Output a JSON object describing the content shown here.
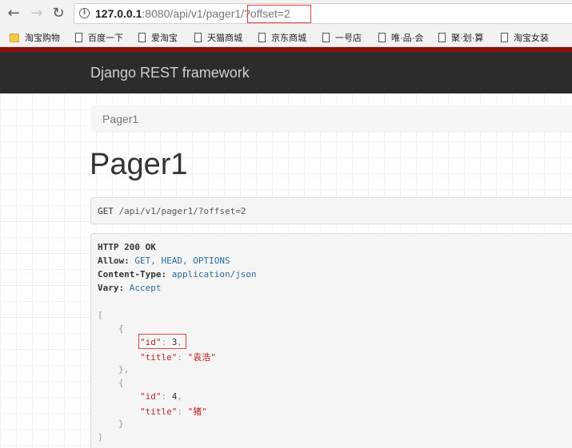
{
  "browser": {
    "back_icon": "arrow-left-icon",
    "forward_icon": "arrow-right-icon",
    "reload_icon": "reload-icon",
    "info_icon": "info-icon",
    "url_host": "127.0.0.1",
    "url_path": ":8080/api/v1/pager1/",
    "url_query": "?offset=2"
  },
  "bookmarks": [
    {
      "label": "淘宝购物",
      "icon": "folder-icon"
    },
    {
      "label": "百度一下",
      "icon": "page-icon"
    },
    {
      "label": "爱淘宝",
      "icon": "page-icon"
    },
    {
      "label": "天猫商城",
      "icon": "page-icon"
    },
    {
      "label": "京东商城",
      "icon": "page-icon"
    },
    {
      "label": "一号店",
      "icon": "page-icon"
    },
    {
      "label": "唯·品·会",
      "icon": "page-icon"
    },
    {
      "label": "聚·划·算",
      "icon": "page-icon"
    },
    {
      "label": "淘宝女装",
      "icon": "page-icon"
    }
  ],
  "navbar": {
    "brand": "Django REST framework"
  },
  "breadcrumb": {
    "item": "Pager1"
  },
  "page": {
    "title": "Pager1"
  },
  "request": {
    "method": "GET",
    "path": "/api/v1/pager1/?offset=2"
  },
  "response": {
    "status_line": "HTTP 200 OK",
    "headers": [
      {
        "key": "Allow:",
        "value": "GET, HEAD, OPTIONS"
      },
      {
        "key": "Content-Type:",
        "value": "application/json"
      },
      {
        "key": "Vary:",
        "value": "Accept"
      }
    ],
    "body": {
      "open_bracket": "[",
      "close_bracket": "]",
      "open_brace": "{",
      "close_brace_comma": "},",
      "close_brace": "}",
      "items": [
        {
          "id_key": "\"id\"",
          "id_value": "3",
          "title_key": "\"title\"",
          "title_value": "\"袁浩\""
        },
        {
          "id_key": "\"id\"",
          "id_value": "4",
          "title_key": "\"title\"",
          "title_value": "\"猪\""
        }
      ]
    }
  },
  "colors": {
    "navbar": "#2c2c2c",
    "accent_red": "#8a1010",
    "highlight": "#dd4444",
    "header_value": "#2d6ca2",
    "json_string": "#bb2222"
  }
}
